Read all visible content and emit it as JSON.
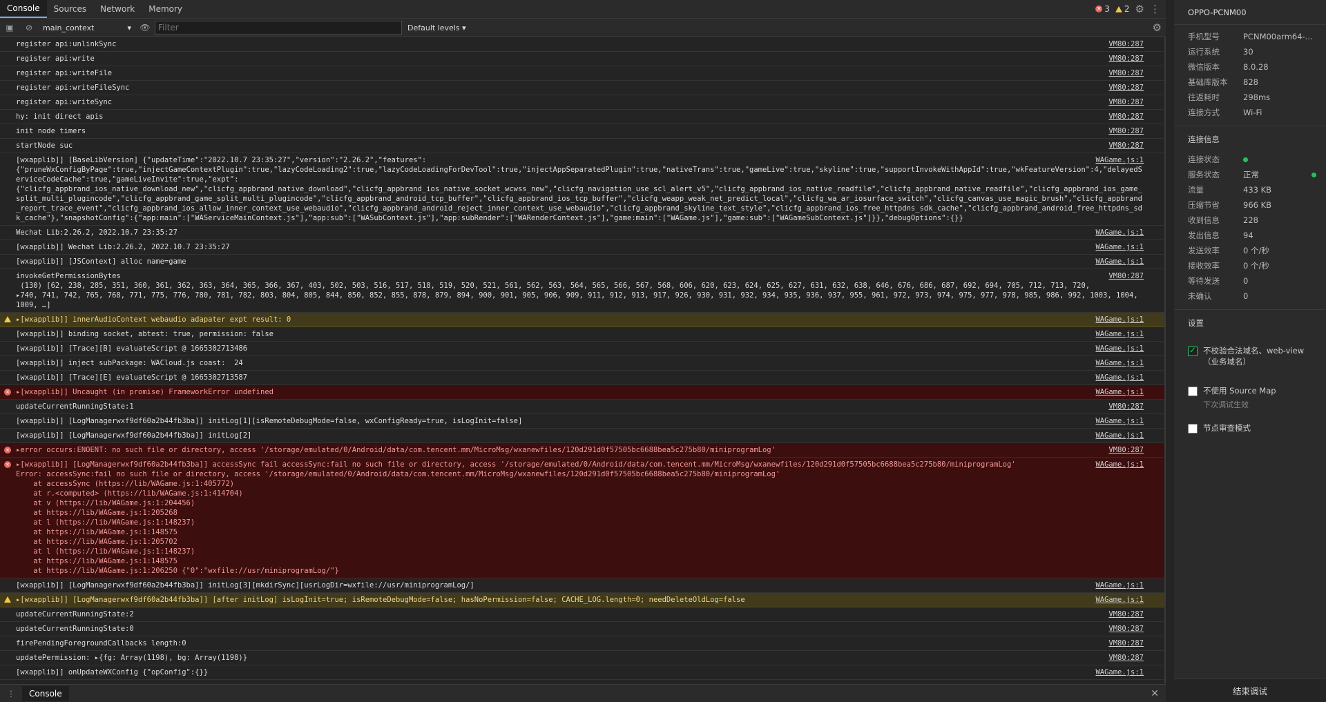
{
  "tabs": [
    "Console",
    "Sources",
    "Network",
    "Memory"
  ],
  "counts": {
    "errors": "3",
    "warnings": "2"
  },
  "toolbar": {
    "context": "main_context",
    "filter_placeholder": "Filter",
    "levels": "Default levels"
  },
  "log": [
    {
      "type": "log",
      "text": "register api:unlinkSync",
      "src": "VM80:287"
    },
    {
      "type": "log",
      "text": "register api:write",
      "src": "VM80:287"
    },
    {
      "type": "log",
      "text": "register api:writeFile",
      "src": "VM80:287"
    },
    {
      "type": "log",
      "text": "register api:writeFileSync",
      "src": "VM80:287"
    },
    {
      "type": "log",
      "text": "register api:writeSync",
      "src": "VM80:287"
    },
    {
      "type": "log",
      "text": "hy: init direct apis",
      "src": "VM80:287"
    },
    {
      "type": "log",
      "text": "init node timers",
      "src": "VM80:287"
    },
    {
      "type": "log",
      "text": "startNode suc",
      "src": "VM80:287"
    },
    {
      "type": "log",
      "text": "[wxapplib]] [BaseLibVersion] {\"updateTime\":\"2022.10.7 23:35:27\",\"version\":\"2.26.2\",\"features\":\n{\"pruneWxConfigByPage\":true,\"injectGameContextPlugin\":true,\"lazyCodeLoading2\":true,\"lazyCodeLoadingForDevTool\":true,\"injectAppSeparatedPlugin\":true,\"nativeTrans\":true,\"gameLive\":true,\"skyline\":true,\"supportInvokeWithAppId\":true,\"wkFeatureVersion\":4,\"delayedServiceCodeCache\":true,\"gameLiveInvite\":true,\"expt\":\n{\"clicfg_appbrand_ios_native_download_new\",\"clicfg_appbrand_native_download\",\"clicfg_appbrand_ios_native_socket_wcwss_new\",\"clicfg_navigation_use_scl_alert_v5\",\"clicfg_appbrand_ios_native_readfile\",\"clicfg_appbrand_native_readfile\",\"clicfg_appbrand_ios_game_split_multi_plugincode\",\"clicfg_appbrand_game_split_multi_plugincode\",\"clicfg_appbrand_android_tcp_buffer\",\"clicfg_appbrand_ios_tcp_buffer\",\"clicfg_weapp_weak_net_predict_local\",\"clicfg_wa_ar_iosurface_switch\",\"clicfg_canvas_use_magic_brush\",\"clicfg_appbrand_report_trace_event\",\"clicfg_appbrand_ios_allow_inner_context_use_webaudio\",\"clicfg_appbrand_android_reject_inner_context_use_webaudio\",\"clicfg_appbrand_skyline_text_style\",\"clicfg_appbrand_ios_free_httpdns_sdk_cache\",\"clicfg_appbrand_android_free_httpdns_sdk_cache\"},\"snapshotConfig\":{\"app:main\":[\"WAServiceMainContext.js\"],\"app:sub\":[\"WASubContext.js\"],\"app:subRender\":[\"WARenderContext.js\"],\"game:main\":[\"WAGame.js\"],\"game:sub\":[\"WAGameSubContext.js\"]}},\"debugOptions\":{}}",
      "src": "WAGame.js:1"
    },
    {
      "type": "log",
      "text": "Wechat Lib:2.26.2, 2022.10.7 23:35:27",
      "src": "WAGame.js:1"
    },
    {
      "type": "log",
      "text": "[wxapplib]] Wechat Lib:2.26.2, 2022.10.7 23:35:27",
      "src": "WAGame.js:1"
    },
    {
      "type": "log",
      "text": "[wxapplib]] [JSContext] alloc name=game",
      "src": "WAGame.js:1"
    },
    {
      "type": "log",
      "text": "invokeGetPermissionBytes\n (130) [62, 238, 285, 351, 360, 361, 362, 363, 364, 365, 366, 367, 403, 502, 503, 516, 517, 518, 519, 520, 521, 561, 562, 563, 564, 565, 566, 567, 568, 606, 620, 623, 624, 625, 627, 631, 632, 638, 646, 676, 686, 687, 692, 694, 705, 712, 713, 720,\n▸740, 741, 742, 765, 768, 771, 775, 776, 780, 781, 782, 803, 804, 805, 844, 850, 852, 855, 878, 879, 894, 900, 901, 905, 906, 909, 911, 912, 913, 917, 926, 930, 931, 932, 934, 935, 936, 937, 955, 961, 972, 973, 974, 975, 977, 978, 985, 986, 992, 1003, 1004, 1009, …]",
      "src": "VM80:287"
    },
    {
      "type": "warn",
      "text": "▸[wxapplib]] innerAudioContext webaudio adapater expt result: 0",
      "src": "WAGame.js:1"
    },
    {
      "type": "log",
      "text": "[wxapplib]] binding socket, abtest: true, permission: false",
      "src": "WAGame.js:1"
    },
    {
      "type": "log",
      "text": "[wxapplib]] [Trace][B] evaluateScript @ 1665302713486",
      "src": "WAGame.js:1"
    },
    {
      "type": "log",
      "text": "[wxapplib]] inject subPackage: WACloud.js coast:  24",
      "src": "WAGame.js:1"
    },
    {
      "type": "log",
      "text": "[wxapplib]] [Trace][E] evaluateScript @ 1665302713587",
      "src": "WAGame.js:1"
    },
    {
      "type": "err",
      "text": "▸[wxapplib]] Uncaught (in promise) FrameworkError undefined",
      "src": "WAGame.js:1"
    },
    {
      "type": "log",
      "text": "updateCurrentRunningState:1",
      "src": "VM80:287"
    },
    {
      "type": "log",
      "text": "[wxapplib]] [LogManagerwxf9df60a2b44fb3ba]] initLog[1][isRemoteDebugMode=false, wxConfigReady=true, isLogInit=false]",
      "src": "WAGame.js:1"
    },
    {
      "type": "log",
      "text": "[wxapplib]] [LogManagerwxf9df60a2b44fb3ba]] initLog[2]",
      "src": "WAGame.js:1"
    },
    {
      "type": "err",
      "text": "▸error occurs:ENOENT: no such file or directory, access '/storage/emulated/0/Android/data/com.tencent.mm/MicroMsg/wxanewfiles/120d291d0f57505bc6688bea5c275b80/miniprogramLog'",
      "src": "VM80:287"
    },
    {
      "type": "err",
      "text": "▸[wxapplib]] [LogManagerwxf9df60a2b44fb3ba]] accessSync fail accessSync:fail no such file or directory, access '/storage/emulated/0/Android/data/com.tencent.mm/MicroMsg/wxanewfiles/120d291d0f57505bc6688bea5c275b80/miniprogramLog'\nError: accessSync:fail no such file or directory, access '/storage/emulated/0/Android/data/com.tencent.mm/MicroMsg/wxanewfiles/120d291d0f57505bc6688bea5c275b80/miniprogramLog'\n    at accessSync (https://lib/WAGame.js:1:405772)\n    at r.<computed> (https://lib/WAGame.js:1:414704)\n    at v (https://lib/WAGame.js:1:204456)\n    at https://lib/WAGame.js:1:205268\n    at l (https://lib/WAGame.js:1:148237)\n    at https://lib/WAGame.js:1:148575\n    at https://lib/WAGame.js:1:205702\n    at l (https://lib/WAGame.js:1:148237)\n    at https://lib/WAGame.js:1:148575\n    at https://lib/WAGame.js:1:206250 {\"0\":\"wxfile://usr/miniprogramLog/\"}",
      "src": "WAGame.js:1"
    },
    {
      "type": "log",
      "text": "[wxapplib]] [LogManagerwxf9df60a2b44fb3ba]] initLog[3][mkdirSync][usrLogDir=wxfile://usr/miniprogramLog/]",
      "src": "WAGame.js:1"
    },
    {
      "type": "warn",
      "text": "▸[wxapplib]] [LogManagerwxf9df60a2b44fb3ba]] [after initLog] isLogInit=true; isRemoteDebugMode=false; hasNoPermission=false; CACHE_LOG.length=0; needDeleteOldLog=false",
      "src": "WAGame.js:1"
    },
    {
      "type": "log",
      "text": "updateCurrentRunningState:2",
      "src": "VM80:287"
    },
    {
      "type": "log",
      "text": "updateCurrentRunningState:0",
      "src": "VM80:287"
    },
    {
      "type": "log",
      "text": "firePendingForegroundCallbacks length:0",
      "src": "VM80:287"
    },
    {
      "type": "log",
      "text": "updatePermission: ▸{fg: Array(1198), bg: Array(1198)}",
      "src": "VM80:287"
    },
    {
      "type": "log",
      "text": "[wxapplib]] onUpdateWXConfig {\"opConfig\":{}}",
      "src": "WAGame.js:1"
    }
  ],
  "bottom": {
    "tab": "Console"
  },
  "panel": {
    "device": "OPPO-PCNM00",
    "info": [
      {
        "k": "手机型号",
        "v": "PCNM00arm64-..."
      },
      {
        "k": "运行系统",
        "v": "30"
      },
      {
        "k": "微信版本",
        "v": "8.0.28"
      },
      {
        "k": "基础库版本",
        "v": "828"
      },
      {
        "k": "往返耗时",
        "v": "298ms"
      },
      {
        "k": "连接方式",
        "v": "Wi-Fi"
      }
    ],
    "conn_title": "连接信息",
    "conn": [
      {
        "k": "连接状态",
        "v": ""
      },
      {
        "k": "服务状态",
        "v": "正常"
      },
      {
        "k": "流量",
        "v": "433 KB"
      },
      {
        "k": "压缩节省",
        "v": "966 KB"
      },
      {
        "k": "收到信息",
        "v": "228"
      },
      {
        "k": "发出信息",
        "v": "94"
      },
      {
        "k": "发送效率",
        "v": "0 个/秒"
      },
      {
        "k": "接收效率",
        "v": "0 个/秒"
      },
      {
        "k": "等待发送",
        "v": "0"
      },
      {
        "k": "未确认",
        "v": "0"
      }
    ],
    "settings_title": "设置",
    "settings": [
      {
        "label": "不校验合法域名、web-view（业务域名）",
        "checked": true,
        "sub": ""
      },
      {
        "label": "不使用 Source Map",
        "checked": false,
        "sub": "下次调试生效"
      },
      {
        "label": "节点审查模式",
        "checked": false,
        "sub": ""
      }
    ],
    "end_button": "结束调试"
  }
}
